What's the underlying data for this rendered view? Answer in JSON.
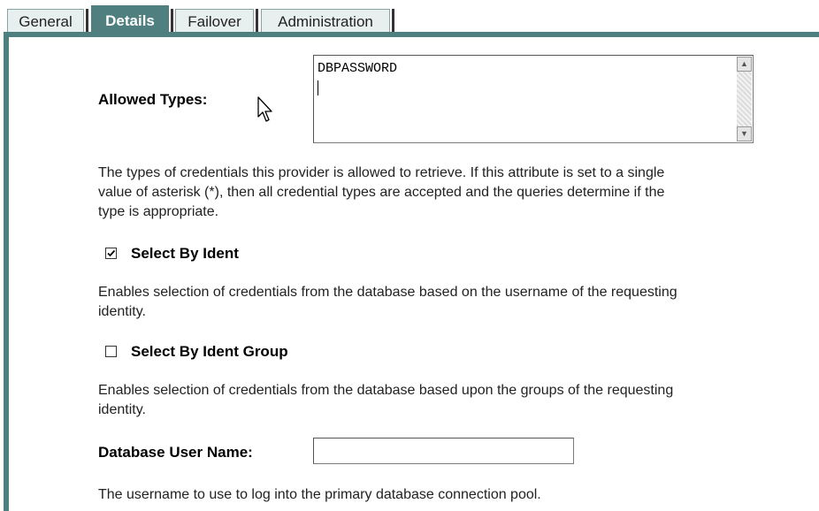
{
  "tabs": [
    {
      "label": "General",
      "active": false
    },
    {
      "label": "Details",
      "active": true
    },
    {
      "label": "Failover",
      "active": false
    },
    {
      "label": "Administration",
      "active": false
    }
  ],
  "colors": {
    "accent": "#4f7f7f",
    "tab_bg": "#e8efef"
  },
  "allowed_types": {
    "label": "Allowed Types:",
    "value": "DBPASSWORD",
    "description": [
      "The types of credentials this provider is allowed to retrieve. If this attribute is set to a single",
      "value of asterisk (*), then all credential types are accepted and the queries determine if the",
      "type is appropriate."
    ]
  },
  "select_by_ident": {
    "label": "Select By Ident",
    "checked": true,
    "description": [
      "Enables selection of credentials from the database based on the username of the requesting",
      "identity."
    ]
  },
  "select_by_ident_group": {
    "label": "Select By Ident Group",
    "checked": false,
    "description": [
      "Enables selection of credentials from the database based upon the groups of the requesting",
      "identity."
    ]
  },
  "database_user_name": {
    "label": "Database User Name:",
    "value": "",
    "description": "The username to use to log into the primary database connection pool."
  },
  "icons": {
    "cursor": "mouse-pointer-icon",
    "check": "checkmark-icon"
  }
}
